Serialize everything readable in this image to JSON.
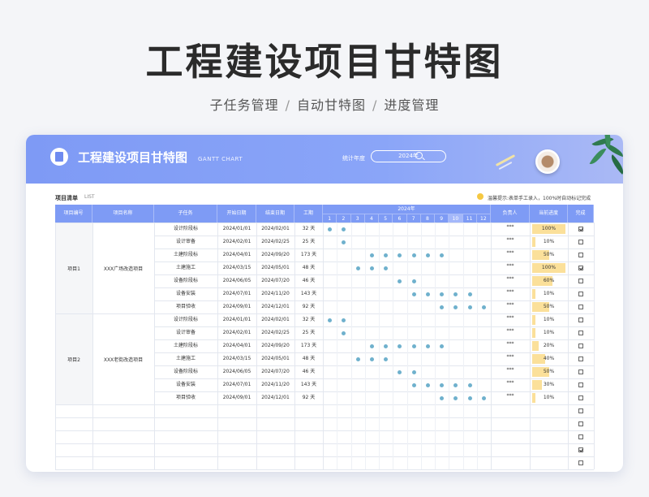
{
  "hero": {
    "title": "工程建设项目甘特图",
    "subtitle": [
      "子任务管理",
      "自动甘特图",
      "进度管理"
    ],
    "separator": "/"
  },
  "banner": {
    "title": "工程建设项目甘特图",
    "subtitle_en": "GANTT CHART",
    "year_label": "统计年度",
    "year_value": "2024年"
  },
  "list": {
    "title": "项目清单",
    "title_en": "LIST",
    "notice": "温馨提示:表单手工录入，100%时自动标记完成"
  },
  "table": {
    "headers": {
      "project_id": "项目编号",
      "project_name": "项目名称",
      "subtask": "子任务",
      "start": "开始日期",
      "end": "结束日期",
      "duration": "工期",
      "year": "2024年",
      "owner": "负责人",
      "progress": "当前进度",
      "done": "完成"
    },
    "months": [
      "1",
      "2",
      "3",
      "4",
      "5",
      "6",
      "7",
      "8",
      "9",
      "10",
      "11",
      "12"
    ],
    "highlight_month": 10,
    "projects": [
      {
        "id": "项目1",
        "name": "XXX广场改造项目",
        "tasks": [
          {
            "task": "设计阶段标",
            "start": "2024/01/01",
            "end": "2024/02/01",
            "duration": "32 天",
            "owner": "***",
            "progress": "100%",
            "progress_value": 100,
            "done": true,
            "months": [
              1,
              2
            ]
          },
          {
            "task": "设计审备",
            "start": "2024/02/01",
            "end": "2024/02/25",
            "duration": "25 天",
            "owner": "***",
            "progress": "10%",
            "progress_value": 10,
            "done": false,
            "months": [
              2
            ]
          },
          {
            "task": "土建阶段标",
            "start": "2024/04/01",
            "end": "2024/09/20",
            "duration": "173 天",
            "owner": "***",
            "progress": "50%",
            "progress_value": 50,
            "done": false,
            "months": [
              4,
              5,
              6,
              7,
              8,
              9
            ]
          },
          {
            "task": "土建施工",
            "start": "2024/03/15",
            "end": "2024/05/01",
            "duration": "48 天",
            "owner": "***",
            "progress": "100%",
            "progress_value": 100,
            "done": true,
            "months": [
              3,
              4,
              5
            ]
          },
          {
            "task": "设备阶段标",
            "start": "2024/06/05",
            "end": "2024/07/20",
            "duration": "46 天",
            "owner": "***",
            "progress": "60%",
            "progress_value": 60,
            "done": false,
            "months": [
              6,
              7
            ]
          },
          {
            "task": "设备安装",
            "start": "2024/07/01",
            "end": "2024/11/20",
            "duration": "143 天",
            "owner": "***",
            "progress": "10%",
            "progress_value": 10,
            "done": false,
            "months": [
              7,
              8,
              9,
              10,
              11
            ]
          },
          {
            "task": "项目验收",
            "start": "2024/09/01",
            "end": "2024/12/01",
            "duration": "92 天",
            "owner": "***",
            "progress": "50%",
            "progress_value": 50,
            "done": false,
            "months": [
              9,
              10,
              11,
              12
            ]
          }
        ]
      },
      {
        "id": "项目2",
        "name": "XXX老街改造项目",
        "tasks": [
          {
            "task": "设计阶段标",
            "start": "2024/01/01",
            "end": "2024/02/01",
            "duration": "32 天",
            "owner": "***",
            "progress": "10%",
            "progress_value": 10,
            "done": false,
            "months": [
              1,
              2
            ]
          },
          {
            "task": "设计审备",
            "start": "2024/02/01",
            "end": "2024/02/25",
            "duration": "25 天",
            "owner": "***",
            "progress": "10%",
            "progress_value": 10,
            "done": false,
            "months": [
              2
            ]
          },
          {
            "task": "土建阶段标",
            "start": "2024/04/01",
            "end": "2024/09/20",
            "duration": "173 天",
            "owner": "***",
            "progress": "20%",
            "progress_value": 20,
            "done": false,
            "months": [
              4,
              5,
              6,
              7,
              8,
              9
            ]
          },
          {
            "task": "土建施工",
            "start": "2024/03/15",
            "end": "2024/05/01",
            "duration": "48 天",
            "owner": "***",
            "progress": "40%",
            "progress_value": 40,
            "done": false,
            "months": [
              3,
              4,
              5
            ]
          },
          {
            "task": "设备阶段标",
            "start": "2024/06/05",
            "end": "2024/07/20",
            "duration": "46 天",
            "owner": "***",
            "progress": "50%",
            "progress_value": 50,
            "done": false,
            "months": [
              6,
              7
            ]
          },
          {
            "task": "设备安装",
            "start": "2024/07/01",
            "end": "2024/11/20",
            "duration": "143 天",
            "owner": "***",
            "progress": "30%",
            "progress_value": 30,
            "done": false,
            "months": [
              7,
              8,
              9,
              10,
              11
            ]
          },
          {
            "task": "项目验收",
            "start": "2024/09/01",
            "end": "2024/12/01",
            "duration": "92 天",
            "owner": "***",
            "progress": "10%",
            "progress_value": 10,
            "done": false,
            "months": [
              9,
              10,
              11,
              12
            ]
          }
        ]
      }
    ],
    "empty_rows_done": [
      false,
      false,
      false,
      true,
      false
    ]
  },
  "colors": {
    "header_blue": "#7e9bf5",
    "dot": "#6fb1cd",
    "progress_fill": "#fbe09a",
    "notice_icon": "#f5c842"
  }
}
